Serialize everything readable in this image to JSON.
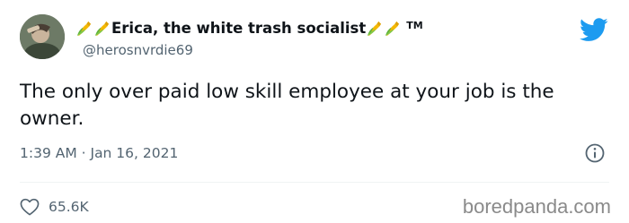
{
  "tweet": {
    "display_name": "Erica, the white trash socialist",
    "trademark": "TM",
    "handle": "@herosnvrdie69",
    "text": "The only over paid low skill employee at your job is the owner.",
    "timestamp": "1:39 AM · Jan 16, 2021",
    "likes": "65.6K",
    "name_emoji": "corn-icon",
    "colors": {
      "twitter_blue": "#1d9bf0",
      "secondary_text": "#536471"
    }
  },
  "watermark": "boredpanda.com",
  "icons": {
    "logo": "twitter-bird-icon",
    "info": "info-icon",
    "like": "heart-icon"
  }
}
